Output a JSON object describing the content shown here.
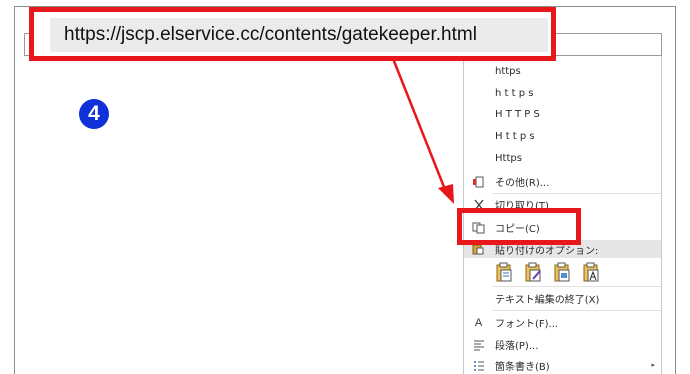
{
  "url_annotation": {
    "text": "https://jscp.elservice.cc/contents/gatekeeper.html"
  },
  "step_badge": {
    "number": "4"
  },
  "context_menu": {
    "spelling_suggestions": [
      "https",
      "h t t p s",
      "H T T P S",
      "H t t p s",
      "Https"
    ],
    "more": "その他(R)...",
    "cut": "切り取り(T)",
    "copy": "コピー(C)",
    "paste_options": "貼り付けのオプション:",
    "end_text_edit": "テキスト編集の終了(X)",
    "font": "フォント(F)...",
    "paragraph": "段落(P)...",
    "bullets": "箇条書き(B)"
  },
  "colors": {
    "highlight_red": "#e8171b",
    "badge_blue": "#1030d8",
    "menu_header_bg": "#e6e6e6"
  },
  "icons": [
    "more-icon",
    "cut-icon",
    "copy-icon",
    "paste-options-icon",
    "paste-keep-format-icon",
    "paste-merge-format-icon",
    "paste-picture-icon",
    "paste-text-only-icon",
    "font-icon",
    "paragraph-icon",
    "bullets-icon",
    "submenu-arrow-icon"
  ]
}
